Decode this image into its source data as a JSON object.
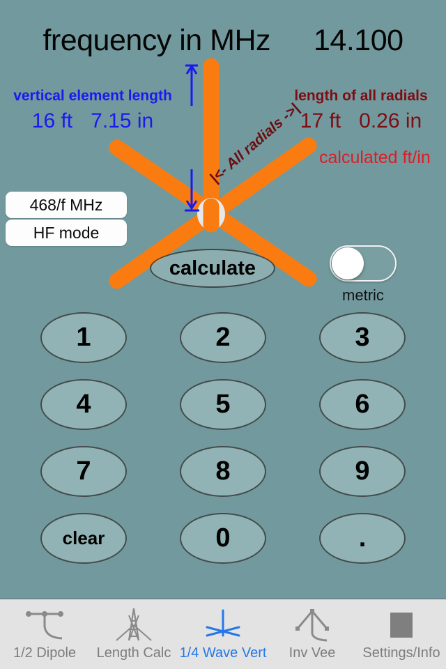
{
  "header": {
    "frequency_label": "frequency in MHz",
    "frequency_value": "14.100"
  },
  "measurements": {
    "vertical": {
      "title": "vertical element length",
      "feet": "16 ft",
      "inches": "7.15 in",
      "color": "#1a1aef"
    },
    "radials": {
      "title": "length of all radials",
      "feet": "17 ft",
      "inches": "0.26 in",
      "color": "#7d0d12"
    },
    "calculated_note": "calculated ft/in",
    "radial_span_note": "|<- All radials ->|"
  },
  "mode_buttons": {
    "formula": "468/f MHz",
    "band": "HF mode"
  },
  "actions": {
    "calculate": "calculate"
  },
  "metric_toggle": {
    "label": "metric",
    "state": "off"
  },
  "keypad": {
    "rows": [
      [
        "1",
        "2",
        "3"
      ],
      [
        "4",
        "5",
        "6"
      ],
      [
        "7",
        "8",
        "9"
      ],
      [
        "clear",
        "0",
        "."
      ]
    ]
  },
  "tabbar": {
    "items": [
      {
        "label": "1/2 Dipole",
        "icon": "dipole-icon",
        "active": false
      },
      {
        "label": "Length Calc",
        "icon": "tower-icon",
        "active": false
      },
      {
        "label": "1/4 Wave Vert",
        "icon": "quarter-wave-icon",
        "active": true
      },
      {
        "label": "Inv Vee",
        "icon": "inverted-vee-icon",
        "active": false
      },
      {
        "label": "Settings/Info",
        "icon": "settings-square-icon",
        "active": false
      }
    ],
    "active_color": "#2577e8",
    "inactive_color": "#7d7d7d"
  },
  "colors": {
    "background": "#729a9e",
    "antenna_orange": "#fa7b0f",
    "tabbar_background": "#e3e3e3"
  }
}
